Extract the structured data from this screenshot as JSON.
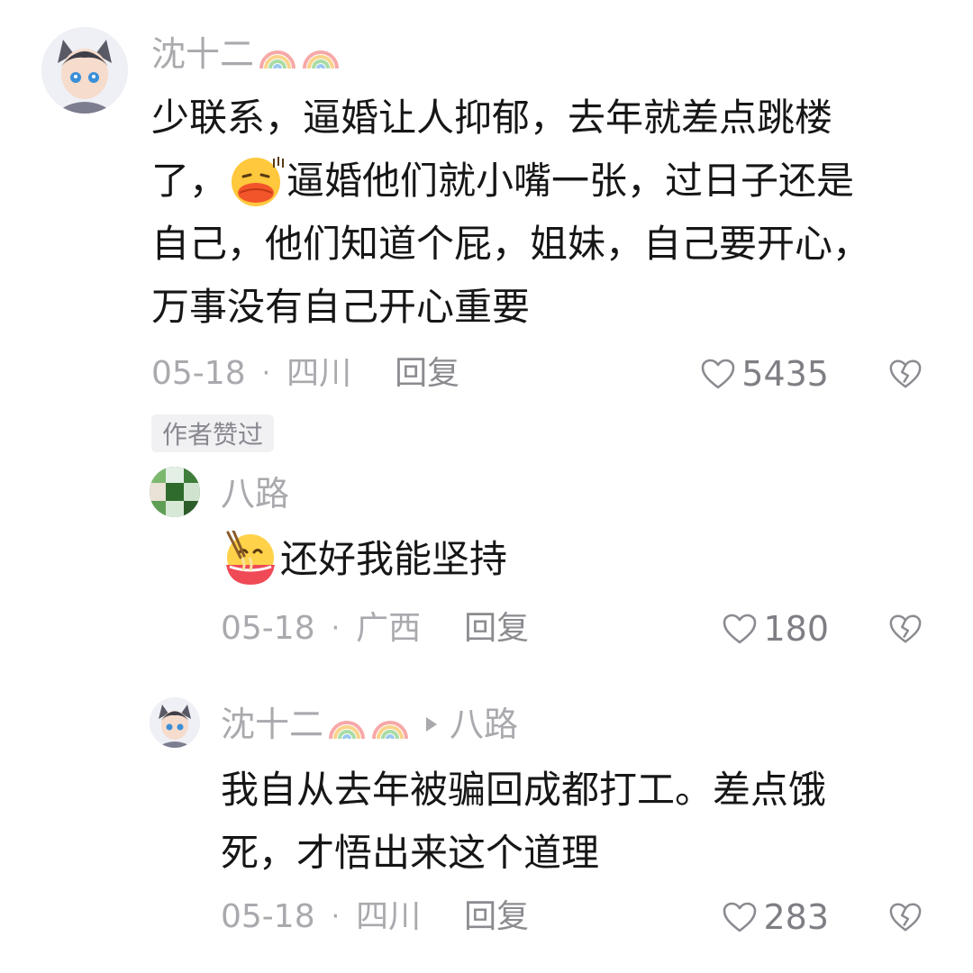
{
  "comments": [
    {
      "author": "沈十二",
      "lines": [
        "少联系，逼婚让人抑郁，去年就差点跳楼",
        "了，",
        "逼婚他们就小嘴一张，过日子还是",
        "自己，他们知道个屁，姐妹，自己要开心，",
        "万事没有自己开心重要"
      ],
      "date": "05-18",
      "separator": "·",
      "location": "四川",
      "reply_label": "回复",
      "likes": "5435",
      "author_liked_tag": "作者赞过"
    },
    {
      "author": "八路",
      "text": "还好我能坚持",
      "date": "05-18",
      "separator": "·",
      "location": "广西",
      "reply_label": "回复",
      "likes": "180"
    },
    {
      "author": "沈十二",
      "reply_to": "八路",
      "lines": [
        "我自从去年被骗回成都打工。差点饿",
        "死，才悟出来这个道理"
      ],
      "date": "05-18",
      "separator": "·",
      "location": "四川",
      "reply_label": "回复",
      "likes": "283"
    }
  ],
  "icons": {
    "name_badges": [
      "rainbow-icon",
      "rainbow-icon"
    ],
    "like": "heart-outline-icon",
    "dislike": "broken-heart-icon",
    "emoji_1": "pouting-lips-emoji",
    "emoji_2": "eating-noodles-emoji"
  },
  "colors": {
    "text_primary": "#161616",
    "text_secondary": "#a9a9ae",
    "tag_bg": "#f1f1f3"
  }
}
